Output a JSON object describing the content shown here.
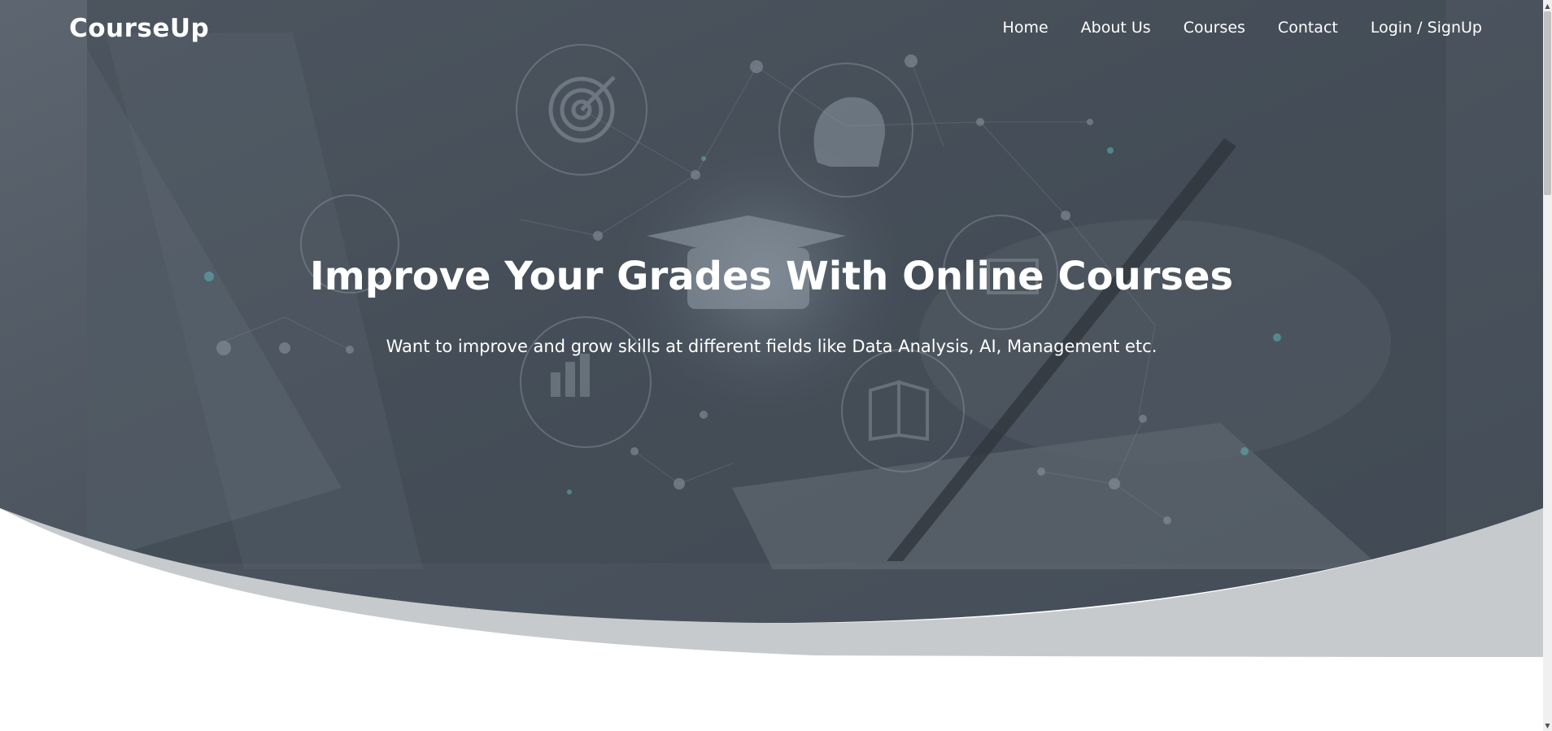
{
  "brand": {
    "logo_text": "CourseUp"
  },
  "nav": {
    "items": [
      {
        "label": "Home"
      },
      {
        "label": "About Us"
      },
      {
        "label": "Courses"
      },
      {
        "label": "Contact"
      },
      {
        "label": "Login / SignUp"
      }
    ]
  },
  "hero": {
    "title": "Improve Your Grades With Online Courses",
    "subtitle": "Want to improve and grow skills at different fields like Data Analysis, AI, Management etc."
  },
  "colors": {
    "hero_overlay": "#4b5560",
    "curve_light": "#c7cacd",
    "text": "#ffffff"
  },
  "scrollbar": {
    "up_arrow_icon": "triangle-up",
    "down_arrow_icon": "triangle-down"
  }
}
